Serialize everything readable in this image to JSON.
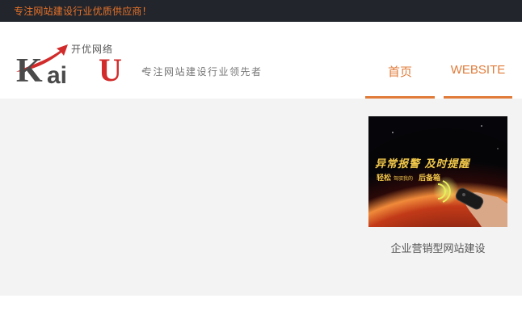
{
  "topbar": {
    "tagline": "专注网站建设行业优质供应商！"
  },
  "brand": {
    "logo_cn": "开优网络",
    "logo_k": "K",
    "logo_ai": "ai",
    "logo_u": "U",
    "slogan": "专注网站建设行业领先者"
  },
  "nav": {
    "items": [
      {
        "label": "首页"
      },
      {
        "label": "WEBSITE"
      }
    ]
  },
  "card": {
    "headline": "异常报警 及时提醒",
    "subline_a": "轻松",
    "subline_b": "驾驭我的",
    "subline_c": "后备箱",
    "caption": "企业营销型网站建设"
  },
  "colors": {
    "accent": "#e07b39",
    "topbar_bg": "#22252c",
    "main_bg": "#f3f3f3",
    "logo_red": "#d22b2b"
  },
  "icons": {
    "logo": "kaiu-logo-swoosh-arrow",
    "fob": "car-key-fob-icon"
  }
}
